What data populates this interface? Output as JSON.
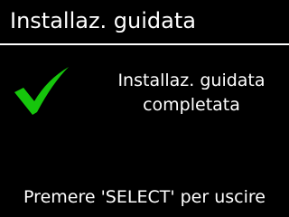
{
  "header": {
    "title": "Installaz. guidata"
  },
  "status": {
    "icon": "checkmark-icon",
    "icon_color": "#16c60c",
    "message_line1": "Installaz. guidata",
    "message_line2": "completata"
  },
  "footer": {
    "hint": "Premere 'SELECT' per uscire"
  },
  "colors": {
    "background": "#000000",
    "text": "#ffffff",
    "rule": "#ffffff"
  }
}
